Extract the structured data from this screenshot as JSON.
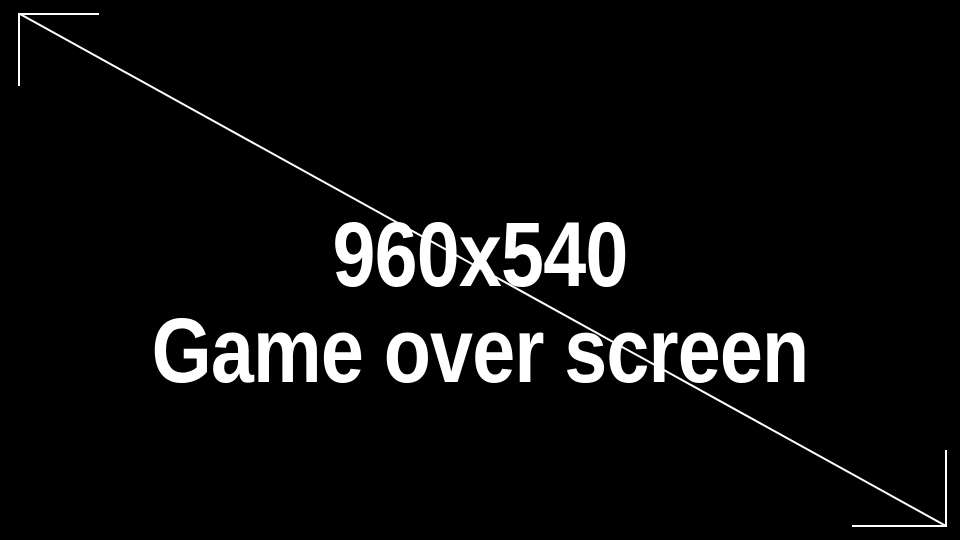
{
  "screen": {
    "dimensions_label": "960x540",
    "title": "Game over screen"
  },
  "colors": {
    "background": "#000000",
    "foreground": "#ffffff"
  },
  "icons": {
    "top_left": "corner-arrow-top-left-icon",
    "bottom_right": "corner-arrow-bottom-right-icon",
    "diagonal": "diagonal-line"
  }
}
